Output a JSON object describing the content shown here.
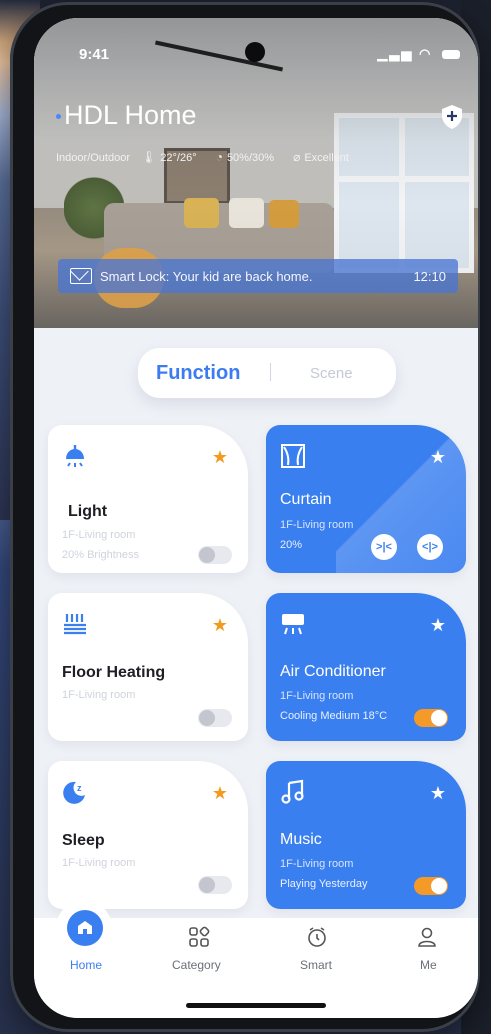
{
  "status": {
    "time": "9:41"
  },
  "header": {
    "title": "HDL Home",
    "env_label": "Indoor/Outdoor",
    "temperature": "22°/26°",
    "humidity": "50%/30%",
    "air_quality": "Excellent"
  },
  "notification": {
    "message": "Smart Lock: Your kid are back home.",
    "time": "12:10"
  },
  "tabs": {
    "function": "Function",
    "scene": "Scene"
  },
  "cards": {
    "light": {
      "name": "Light",
      "room": "1F-Living room",
      "info": "20% Brightness",
      "on": false
    },
    "curtain": {
      "name": "Curtain",
      "room": "1F-Living room",
      "info": "20%"
    },
    "floor_heating": {
      "name": "Floor Heating",
      "room": "1F-Living room",
      "on": false
    },
    "ac": {
      "name": "Air Conditioner",
      "room": "1F-Living room",
      "info": "Cooling Medium 18°C",
      "on": true
    },
    "sleep": {
      "name": "Sleep",
      "room": "1F-Living room",
      "on": false
    },
    "music": {
      "name": "Music",
      "room": "1F-Living room",
      "info": "Playing  Yesterday",
      "on": true
    }
  },
  "nav": {
    "home": "Home",
    "category": "Category",
    "smart": "Smart",
    "me": "Me"
  },
  "colors": {
    "accent": "#3a7ff0",
    "favorite": "#f39a1d",
    "toggle_on": "#f49a28"
  }
}
